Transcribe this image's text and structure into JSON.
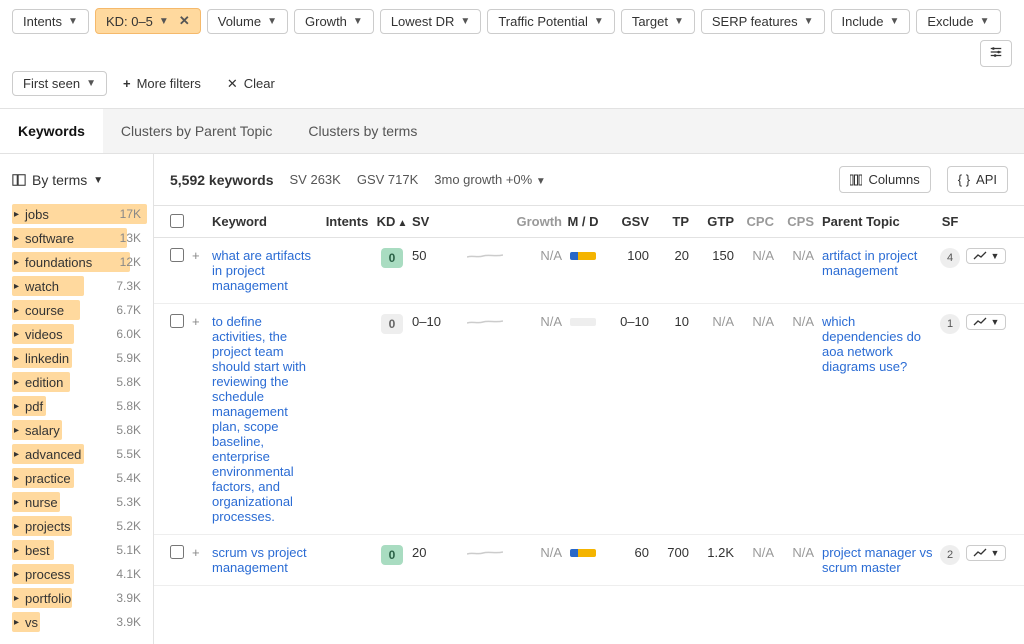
{
  "filters": {
    "intents": "Intents",
    "kd": "KD: 0–5",
    "volume": "Volume",
    "growth": "Growth",
    "lowest_dr": "Lowest DR",
    "traffic_potential": "Traffic Potential",
    "target": "Target",
    "serp_features": "SERP features",
    "include": "Include",
    "exclude": "Exclude",
    "first_seen": "First seen",
    "more_filters": "More filters",
    "clear": "Clear"
  },
  "tabs": {
    "keywords": "Keywords",
    "clusters_parent": "Clusters by Parent Topic",
    "clusters_terms": "Clusters by terms"
  },
  "sidebar": {
    "by_terms": "By terms",
    "terms": [
      {
        "label": "jobs",
        "count": "17K",
        "bar": 135
      },
      {
        "label": "software",
        "count": "13K",
        "bar": 115
      },
      {
        "label": "foundations",
        "count": "12K",
        "bar": 118
      },
      {
        "label": "watch",
        "count": "7.3K",
        "bar": 72
      },
      {
        "label": "course",
        "count": "6.7K",
        "bar": 68
      },
      {
        "label": "videos",
        "count": "6.0K",
        "bar": 62
      },
      {
        "label": "linkedin",
        "count": "5.9K",
        "bar": 60
      },
      {
        "label": "edition",
        "count": "5.8K",
        "bar": 58
      },
      {
        "label": "pdf",
        "count": "5.8K",
        "bar": 34
      },
      {
        "label": "salary",
        "count": "5.8K",
        "bar": 50
      },
      {
        "label": "advanced",
        "count": "5.5K",
        "bar": 72
      },
      {
        "label": "practice",
        "count": "5.4K",
        "bar": 62
      },
      {
        "label": "nurse",
        "count": "5.3K",
        "bar": 48
      },
      {
        "label": "projects",
        "count": "5.2K",
        "bar": 60
      },
      {
        "label": "best",
        "count": "5.1K",
        "bar": 42
      },
      {
        "label": "process",
        "count": "4.1K",
        "bar": 62
      },
      {
        "label": "portfolio",
        "count": "3.9K",
        "bar": 60
      },
      {
        "label": "vs",
        "count": "3.9K",
        "bar": 28
      }
    ]
  },
  "summary": {
    "kw_count": "5,592 keywords",
    "sv": "SV 263K",
    "gsv": "GSV 717K",
    "growth": "3mo growth +0%",
    "columns_btn": "Columns",
    "api_btn": "API"
  },
  "headers": {
    "keyword": "Keyword",
    "intents": "Intents",
    "kd": "KD",
    "sv": "SV",
    "growth": "Growth",
    "md": "M / D",
    "gsv": "GSV",
    "tp": "TP",
    "gtp": "GTP",
    "cpc": "CPC",
    "cps": "CPS",
    "parent": "Parent Topic",
    "sf": "SF"
  },
  "rows": [
    {
      "keyword": "what are artifacts in project management",
      "kd": "0",
      "kd_class": "green",
      "sv": "50",
      "growth": "N/A",
      "md": "bar",
      "gsv": "100",
      "tp": "20",
      "gtp": "150",
      "cpc": "N/A",
      "cps": "N/A",
      "parent": "artifact in project management",
      "sf": "4"
    },
    {
      "keyword": "to define activities, the project team should start with reviewing the schedule management plan, scope baseline, enterprise environmental factors, and organizational processes.",
      "kd": "0",
      "kd_class": "grey",
      "sv": "0–10",
      "growth": "N/A",
      "md": "empty",
      "gsv": "0–10",
      "tp": "10",
      "gtp": "N/A",
      "cpc": "N/A",
      "cps": "N/A",
      "parent": "which dependencies do aoa network diagrams use?",
      "sf": "1"
    },
    {
      "keyword": "scrum vs project management",
      "kd": "0",
      "kd_class": "green",
      "sv": "20",
      "growth": "N/A",
      "md": "bar",
      "gsv": "60",
      "tp": "700",
      "gtp": "1.2K",
      "cpc": "N/A",
      "cps": "N/A",
      "parent": "project manager vs scrum master",
      "sf": "2"
    }
  ]
}
